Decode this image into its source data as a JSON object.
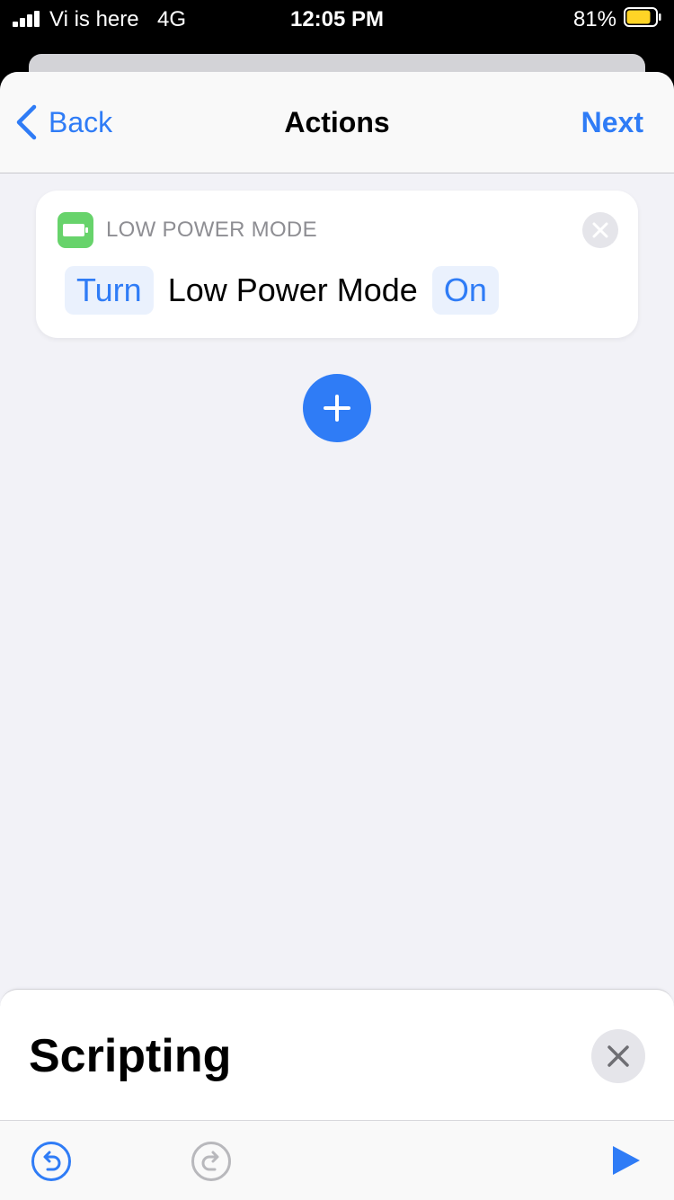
{
  "status_bar": {
    "carrier": "Vi is here",
    "network": "4G",
    "time": "12:05 PM",
    "battery_percent": "81%",
    "battery_level": 0.81,
    "battery_color": "#ffd426"
  },
  "nav": {
    "back_label": "Back",
    "title": "Actions",
    "next_label": "Next"
  },
  "action": {
    "header": "LOW POWER MODE",
    "icon": "battery-icon",
    "icon_color": "#67d36b",
    "verb": "Turn",
    "target": "Low Power Mode",
    "state": "On"
  },
  "bottom_sheet": {
    "title": "Scripting"
  },
  "colors": {
    "accent": "#2f7cf6",
    "background": "#f2f2f7"
  }
}
